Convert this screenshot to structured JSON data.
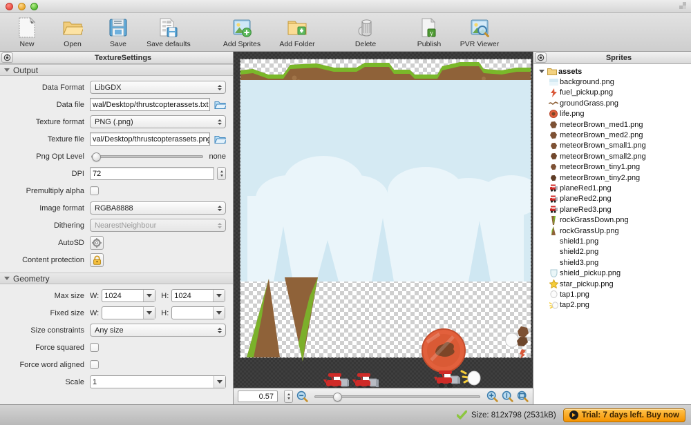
{
  "window": {
    "traffic_lights": [
      "close",
      "minimize",
      "zoom"
    ],
    "resize_icon": "resize-corner-icon"
  },
  "toolbar": {
    "items": [
      {
        "label": "New",
        "icon": "new-document-icon"
      },
      {
        "label": "Open",
        "icon": "open-folder-icon"
      },
      {
        "label": "Save",
        "icon": "save-floppy-icon"
      },
      {
        "label": "Save defaults",
        "icon": "save-defaults-icon"
      },
      {
        "label": "Add Sprites",
        "icon": "add-sprites-icon"
      },
      {
        "label": "Add Folder",
        "icon": "add-folder-icon"
      },
      {
        "label": "Delete",
        "icon": "trash-delete-icon"
      },
      {
        "label": "Publish",
        "icon": "publish-document-icon"
      },
      {
        "label": "PVR Viewer",
        "icon": "pvr-viewer-icon"
      }
    ]
  },
  "settings_panel": {
    "header_title": "TextureSettings",
    "header_button_icon": "panel-menu-icon",
    "sections": {
      "output": {
        "title": "Output",
        "fields": {
          "data_format": {
            "label": "Data Format",
            "value": "LibGDX"
          },
          "data_file": {
            "label": "Data file",
            "value": "wal/Desktop/thrustcopterassets.txt"
          },
          "texture_format": {
            "label": "Texture format",
            "value": "PNG (.png)"
          },
          "texture_file": {
            "label": "Texture file",
            "value": "val/Desktop/thrustcopterassets.png"
          },
          "png_opt_level": {
            "label": "Png Opt Level",
            "value": "none"
          },
          "dpi": {
            "label": "DPI",
            "value": "72"
          },
          "premultiply_alpha": {
            "label": "Premultiply alpha",
            "value": ""
          },
          "image_format": {
            "label": "Image format",
            "value": "RGBA8888"
          },
          "dithering": {
            "label": "Dithering",
            "value": "NearestNeighbour"
          },
          "autosd": {
            "label": "AutoSD",
            "value": ""
          },
          "content_protection": {
            "label": "Content protection",
            "value": ""
          }
        }
      },
      "geometry": {
        "title": "Geometry",
        "fields": {
          "max_size": {
            "label": "Max size",
            "w_label": "W:",
            "w_value": "1024",
            "h_label": "H:",
            "h_value": "1024"
          },
          "fixed_size": {
            "label": "Fixed size",
            "w_label": "W:",
            "w_value": "",
            "h_label": "H:",
            "h_value": ""
          },
          "size_constraints": {
            "label": "Size constraints",
            "value": "Any size"
          },
          "force_squared": {
            "label": "Force squared",
            "value": ""
          },
          "force_word_aligned": {
            "label": "Force word aligned",
            "value": ""
          },
          "scale": {
            "label": "Scale",
            "value": "1"
          }
        }
      }
    }
  },
  "canvas": {
    "zoom_value": "0.57",
    "zoom_out_icon": "zoom-out-icon",
    "zoom_in_icon": "zoom-in-icon",
    "zoom_actual_icon": "zoom-actual-size-icon",
    "zoom_fit_icon": "zoom-fit-icon"
  },
  "sprites_panel": {
    "header_title": "Sprites",
    "header_button_icon": "panel-menu-icon",
    "root": {
      "label": "assets",
      "icon": "folder-icon",
      "expanded": true
    },
    "items": [
      {
        "label": "background.png",
        "icon": "sprite-background-icon"
      },
      {
        "label": "fuel_pickup.png",
        "icon": "sprite-fuel-icon"
      },
      {
        "label": "groundGrass.png",
        "icon": "sprite-ground-icon"
      },
      {
        "label": "life.png",
        "icon": "sprite-life-icon"
      },
      {
        "label": "meteorBrown_med1.png",
        "icon": "sprite-meteor-icon"
      },
      {
        "label": "meteorBrown_med2.png",
        "icon": "sprite-meteor-icon"
      },
      {
        "label": "meteorBrown_small1.png",
        "icon": "sprite-meteor-icon"
      },
      {
        "label": "meteorBrown_small2.png",
        "icon": "sprite-meteor-icon"
      },
      {
        "label": "meteorBrown_tiny1.png",
        "icon": "sprite-meteor-icon"
      },
      {
        "label": "meteorBrown_tiny2.png",
        "icon": "sprite-meteor-icon"
      },
      {
        "label": "planeRed1.png",
        "icon": "sprite-plane-icon"
      },
      {
        "label": "planeRed2.png",
        "icon": "sprite-plane-icon"
      },
      {
        "label": "planeRed3.png",
        "icon": "sprite-plane-icon"
      },
      {
        "label": "rockGrassDown.png",
        "icon": "sprite-rock-down-icon"
      },
      {
        "label": "rockGrassUp.png",
        "icon": "sprite-rock-up-icon"
      },
      {
        "label": "shield1.png",
        "icon": "sprite-blank-icon"
      },
      {
        "label": "shield2.png",
        "icon": "sprite-blank-icon"
      },
      {
        "label": "shield3.png",
        "icon": "sprite-blank-icon"
      },
      {
        "label": "shield_pickup.png",
        "icon": "sprite-shield-icon"
      },
      {
        "label": "star_pickup.png",
        "icon": "sprite-star-icon"
      },
      {
        "label": "tap1.png",
        "icon": "sprite-tap1-icon"
      },
      {
        "label": "tap2.png",
        "icon": "sprite-tap2-icon"
      }
    ]
  },
  "statusbar": {
    "status_icon": "green-check-icon",
    "size_text": "Size: 812x798 (2531kB)",
    "trial_text": "Trial: 7 days left. Buy now",
    "trial_icon": "arrow-right-circle-icon"
  },
  "colors": {
    "accent_orange": "#f59300",
    "status_green": "#8cc63f",
    "grass_green": "#7ab82a",
    "dirt_brown": "#8f6239",
    "plane_red": "#cf2b28",
    "sky_blue": "#d5eaf3"
  }
}
